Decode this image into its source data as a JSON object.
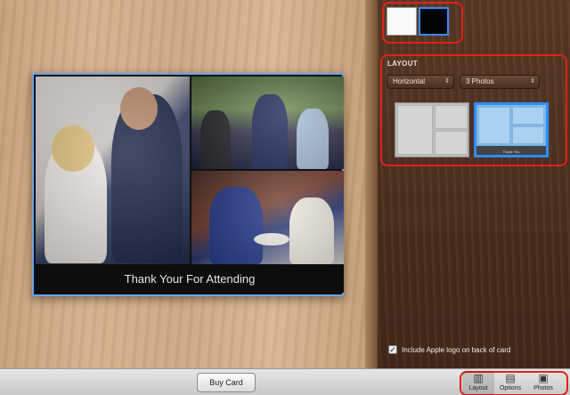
{
  "card": {
    "caption": "Thank Your For Attending"
  },
  "panel": {
    "colors": [
      "#fafafa",
      "#050508"
    ],
    "layout_section_label": "LAYOUT",
    "orientation_select": "Horizontal",
    "photo_count_select": "3 Photos",
    "selected_thumb_caption": "Thank You",
    "checkbox_checked": true,
    "checkbox_label": "Include Apple logo on back of card"
  },
  "toolbar": {
    "buy_button": "Buy Card",
    "tabs": [
      {
        "label": "Layout",
        "icon": "layout-icon"
      },
      {
        "label": "Options",
        "icon": "options-icon"
      },
      {
        "label": "Photos",
        "icon": "photos-icon"
      }
    ]
  },
  "accent_colors": {
    "highlight": "#e02218",
    "selection": "#2f8cff"
  }
}
